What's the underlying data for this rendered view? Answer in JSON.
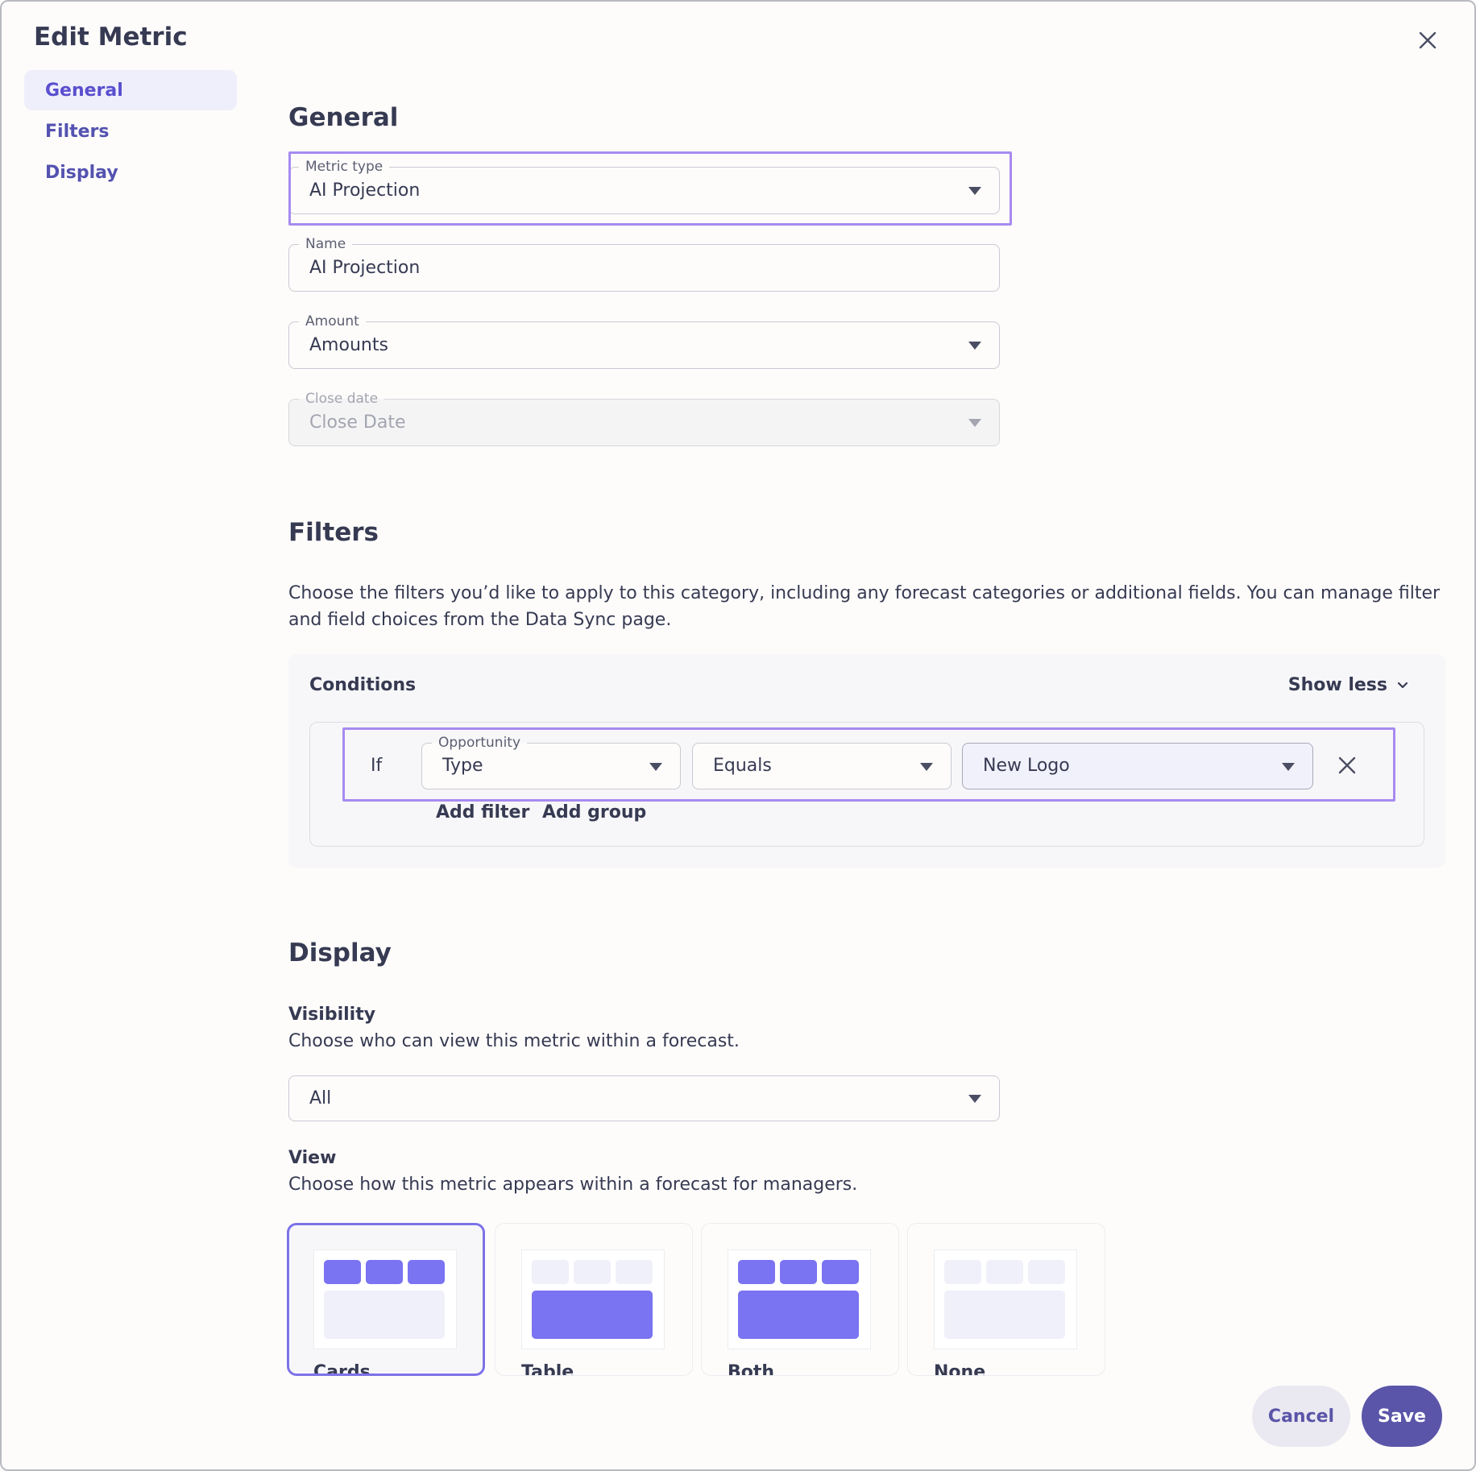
{
  "modal": {
    "title": "Edit Metric"
  },
  "nav": {
    "items": [
      {
        "label": "General",
        "active": true
      },
      {
        "label": "Filters",
        "active": false
      },
      {
        "label": "Display",
        "active": false
      }
    ]
  },
  "general": {
    "title": "General",
    "metric_type": {
      "label": "Metric type",
      "value": "AI Projection"
    },
    "name": {
      "label": "Name",
      "value": "AI Projection"
    },
    "amount": {
      "label": "Amount",
      "value": "Amounts"
    },
    "close_date": {
      "label": "Close date",
      "value": "Close Date",
      "disabled": true
    }
  },
  "filters": {
    "title": "Filters",
    "description": "Choose the filters you’d like to apply to this category, including any forecast categories or additional fields. You can manage filter and field choices from the Data Sync page.",
    "conditions": {
      "title": "Conditions",
      "toggle_label": "Show less",
      "rows": [
        {
          "prefix": "If",
          "field": {
            "label": "Opportunity",
            "value": "Type"
          },
          "operator": {
            "value": "Equals"
          },
          "value": {
            "value": "New Logo"
          }
        }
      ],
      "add_filter_label": "Add filter",
      "add_group_label": "Add group"
    }
  },
  "display": {
    "title": "Display",
    "visibility": {
      "label": "Visibility",
      "description": "Choose who can view this metric within a forecast.",
      "value": "All"
    },
    "view": {
      "label": "View",
      "description": "Choose how this metric appears within a forecast for managers.",
      "options": [
        {
          "label": "Cards",
          "selected": true
        },
        {
          "label": "Table",
          "selected": false
        },
        {
          "label": "Both",
          "selected": false
        },
        {
          "label": "None",
          "selected": false
        }
      ]
    }
  },
  "footer": {
    "cancel_label": "Cancel",
    "save_label": "Save"
  },
  "colors": {
    "accent": "#5a4fcf",
    "primary_button": "#5a55a8",
    "highlight": "#a78bf0",
    "preview_fill": "#7a73f2"
  }
}
